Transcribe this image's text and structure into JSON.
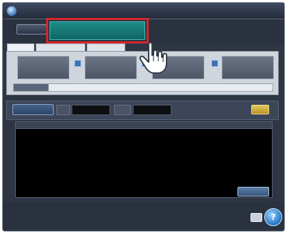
{
  "colors": {
    "window_bg": "#2e3644",
    "highlight_border": "#d9252d",
    "highlight_item": "#1e8c88",
    "search_go": "#d4b04a",
    "list_bg": "#000000"
  },
  "titlebar": {
    "logo_icon": "app-logo-icon",
    "title": ""
  },
  "navbar": {
    "menu_label": "",
    "highlighted_item_label": ""
  },
  "tabs": [
    {
      "label": ""
    },
    {
      "label": ""
    },
    {
      "label": ""
    }
  ],
  "cards": [
    {
      "title": "",
      "sub": ""
    },
    {
      "title": "",
      "sub": ""
    },
    {
      "title": "",
      "sub": ""
    },
    {
      "title": "",
      "sub": ""
    }
  ],
  "progress": {
    "label": ""
  },
  "search": {
    "button_label": "",
    "field_label": "",
    "go_label": ""
  },
  "list": {
    "columns": [
      "",
      "",
      ""
    ],
    "button_label": ""
  },
  "bottom": {
    "icon": "screen-icon",
    "help_label": "?"
  },
  "pointer": {
    "icon": "hand-pointer-icon"
  }
}
